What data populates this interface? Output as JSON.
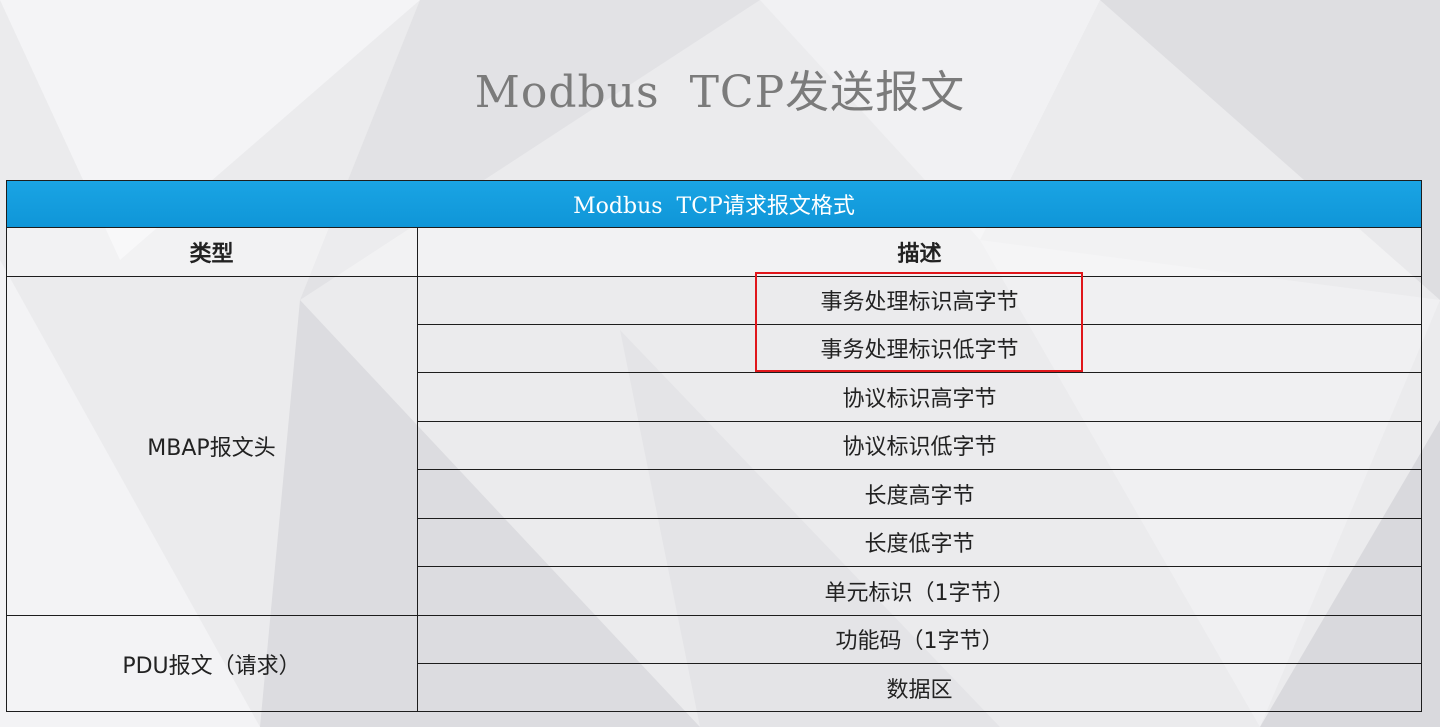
{
  "slide": {
    "title": "Modbus  TCP发送报文"
  },
  "table": {
    "caption": "Modbus  TCP请求报文格式",
    "headers": [
      "类型",
      "描述"
    ],
    "groups": [
      {
        "type": "MBAP报文头",
        "rows": [
          "事务处理标识高字节",
          "事务处理标识低字节",
          "协议标识高字节",
          "协议标识低字节",
          "长度高字节",
          "长度低字节",
          "单元标识（1字节）"
        ]
      },
      {
        "type": "PDU报文（请求）",
        "rows": [
          "功能码（1字节）",
          "数据区"
        ]
      }
    ]
  },
  "colors": {
    "caption_bar": "#1aa4e4",
    "highlight_box": "#e0161b"
  }
}
